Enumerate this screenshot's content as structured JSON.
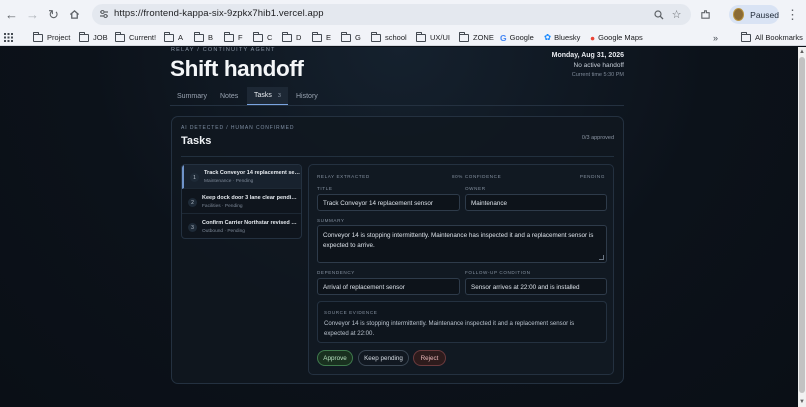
{
  "browser": {
    "url": "https://frontend-kappa-six-9zpkx7hib1.vercel.app",
    "profile_label": "Paused",
    "bookmarks": [
      "Project",
      "JOB",
      "Current!",
      "A",
      "B",
      "F",
      "C",
      "D",
      "E",
      "G",
      "school",
      "UX/UI",
      "ZONE",
      "Google",
      "Bluesky",
      "Google Maps"
    ],
    "all_bookmarks": "All Bookmarks",
    "overflow_icon": "double-chevron-right-icon"
  },
  "header": {
    "eyebrow": "RELAY / CONTINUITY AGENT",
    "title": "Shift handoff",
    "date": "Monday, Aug 31, 2026",
    "status": "No active handoff",
    "current_time": "Current time 5:30 PM"
  },
  "tabs": [
    {
      "label": "Summary",
      "active": false
    },
    {
      "label": "Notes",
      "active": false
    },
    {
      "label": "Tasks",
      "badge": "3",
      "active": true
    },
    {
      "label": "History",
      "active": false
    }
  ],
  "tasks_card": {
    "eyebrow": "AI DETECTED / HUMAN CONFIRMED",
    "heading": "Tasks",
    "approved_count": "0/3 approved",
    "items": [
      {
        "num": "1",
        "title": "Track Conveyor 14 replacement sensor",
        "meta": "Maintenance · Pending",
        "active": true
      },
      {
        "num": "2",
        "title": "Keep dock door 3 lane clear pending...",
        "meta": "Facilities · Pending",
        "active": false
      },
      {
        "num": "3",
        "title": "Confirm Carrier Northstar revised ar...",
        "meta": "Outbound · Pending",
        "active": false
      }
    ]
  },
  "detail": {
    "extracted_label": "RELAY EXTRACTED",
    "confidence": "80% CONFIDENCE",
    "state": "PENDING",
    "title_label": "TITLE",
    "title_value": "Track Conveyor 14 replacement sensor",
    "owner_label": "OWNER",
    "owner_value": "Maintenance",
    "summary_label": "SUMMARY",
    "summary_value": "Conveyor 14 is stopping intermittently. Maintenance has inspected it and a replacement sensor is expected to arrive.",
    "dependency_label": "DEPENDENCY",
    "dependency_value": "Arrival of replacement sensor",
    "followup_label": "FOLLOW-UP CONDITION",
    "followup_value": "Sensor arrives at 22:00 and is installed",
    "evidence_label": "SOURCE EVIDENCE",
    "evidence_text": "Conveyor 14 is stopping intermittently. Maintenance inspected it and a replacement sensor is expected at 22:00.",
    "buttons": {
      "approve": "Approve",
      "keep": "Keep pending",
      "reject": "Reject"
    }
  },
  "colors": {
    "page_bg": "#0b1119",
    "accent": "#7aa4e0",
    "approve": "#3f7a4d",
    "reject": "#6b3a3d"
  }
}
